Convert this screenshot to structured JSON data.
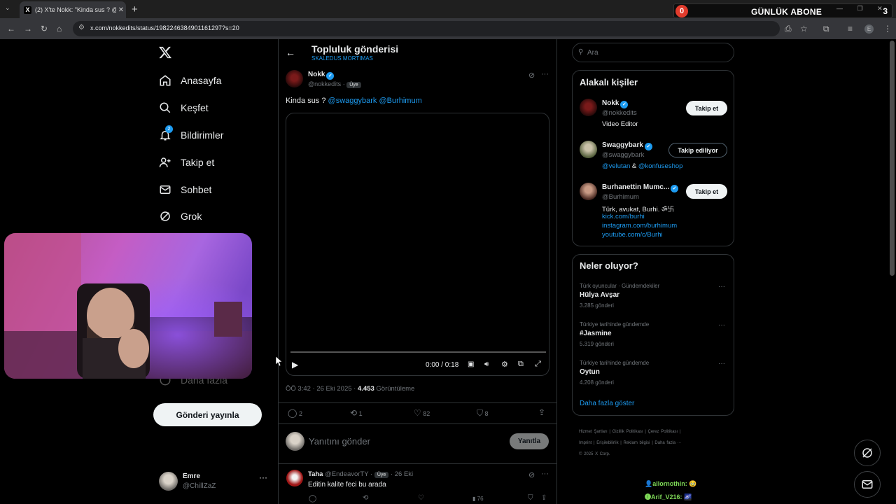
{
  "browser": {
    "tab_title": "(2) X'te Nokk: \"Kinda sus ? @sw",
    "tab_favicon": "X",
    "url": "x.com/nokkedits/status/1982246384901161297?s=20"
  },
  "stream_widget": {
    "count": "0",
    "label": "GÜNLÜK ABONE",
    "goal": "3"
  },
  "nav": {
    "logo": "X",
    "items": [
      {
        "label": "Anasayfa",
        "icon": "home-icon"
      },
      {
        "label": "Keşfet",
        "icon": "search-icon"
      },
      {
        "label": "Bildirimler",
        "icon": "bell-icon",
        "badge": "2"
      },
      {
        "label": "Takip et",
        "icon": "follow-icon"
      },
      {
        "label": "Sohbet",
        "icon": "mail-icon"
      },
      {
        "label": "Grok",
        "icon": "grok-icon"
      },
      {
        "label": "Daha fazla",
        "icon": "more-icon"
      }
    ],
    "post_button": "Gönderi yayınla",
    "account": {
      "name": "Emre",
      "handle": "@ChillZaZ"
    }
  },
  "post_header": {
    "title": "Topluluk gönderisi",
    "community": "SKALEDUS MORTIMAS"
  },
  "post": {
    "author": "Nokk",
    "handle": "@nokkedits",
    "sep": "·",
    "member_badge": "Üye",
    "text": "Kinda sus ?",
    "mentions": "@swaggybark @Burhimum",
    "video": {
      "time": "0:00 / 0:18",
      "progress": 0
    },
    "timestamp": "ÖÖ 3:42 · 26 Eki 2025 · ",
    "views_value": "4.453",
    "views_label": "Görüntüleme",
    "stats": {
      "replies": "2",
      "reposts": "1",
      "likes": "82",
      "bookmarks": "8"
    }
  },
  "reply_box": {
    "placeholder": "Yanıtını gönder",
    "button": "Yanıtla"
  },
  "reply": {
    "author": "Taha",
    "handle": "@EndeavorTY",
    "badge": "Üye",
    "date": "· 26 Eki",
    "text": "Editin kalite feci bu arada",
    "views": "76"
  },
  "search": {
    "placeholder": "Ara"
  },
  "related": {
    "title": "Alakalı kişiler",
    "people": [
      {
        "name": "Nokk",
        "handle": "@nokkedits",
        "bio": "Video Editor",
        "button": "Takip et",
        "state": "follow"
      },
      {
        "name": "Swaggybark",
        "handle": "@swaggybark",
        "bio_link1": "@velutan",
        "bio_mid": " & ",
        "bio_link2": "@konfuseshop",
        "button": "Takip ediliyor",
        "state": "following"
      },
      {
        "name": "Burhanettin Mumc...",
        "handle": "@Burhimum",
        "bio": "Türk, avukat, Burhi. ॐ卐",
        "links": [
          "kick.com/burhi",
          "instagram.com/burhimum",
          "youtube.com/c/Burhi"
        ],
        "button": "Takip et",
        "state": "follow"
      }
    ]
  },
  "trends": {
    "title": "Neler oluyor?",
    "items": [
      {
        "meta": "Türk oyuncular · Gündemdekiler",
        "name": "Hülya Avşar",
        "count": "3.285 gönderi"
      },
      {
        "meta": "Türkiye tarihinde gündemde",
        "name": "#Jasmine",
        "count": "5.319 gönderi"
      },
      {
        "meta": "Türkiye tarihinde gündemde",
        "name": "Oytun",
        "count": "4.208 gönderi"
      }
    ],
    "show_more": "Daha fazla göster"
  },
  "footer": {
    "links": [
      "Hizmet Şartları",
      "|",
      "Gizlilik Politikası",
      "|",
      "Çerez Politikası",
      "|",
      "Imprint",
      "|",
      "Erişilebilirlik",
      "|",
      "Reklam bilgisi",
      "|",
      "Daha fazla ···"
    ],
    "copyright": "© 2025 X Corp."
  },
  "chat_overlay": [
    {
      "user": "allornothin:",
      "emote": "🥹"
    },
    {
      "user": "Arif_V216:",
      "emote": "🌌"
    }
  ],
  "colors": {
    "accent": "#1d9bf0",
    "background": "#000000",
    "border": "#2f3336",
    "muted": "#71767b",
    "text": "#e7e9ea",
    "stream_red": "#e23b2c"
  }
}
